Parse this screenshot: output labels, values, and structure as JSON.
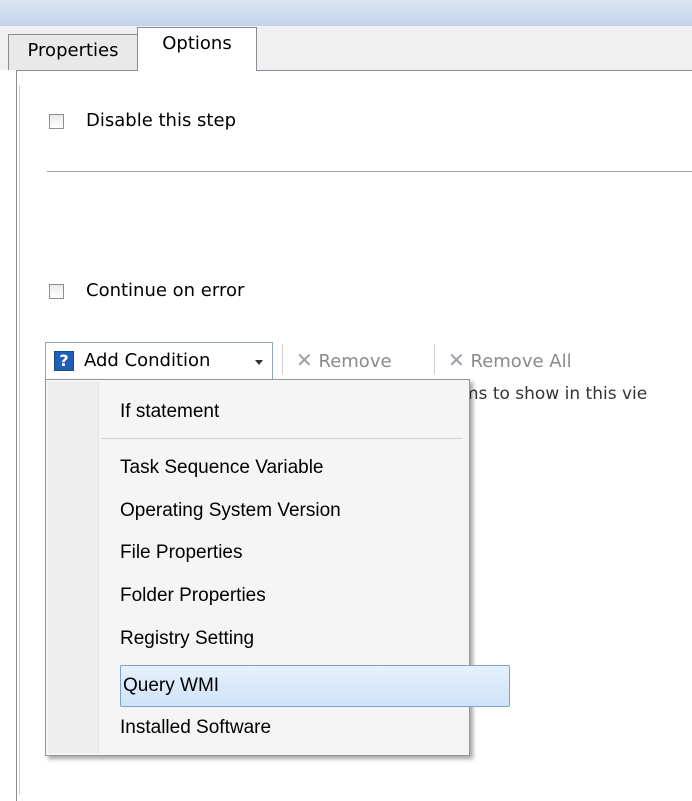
{
  "tabs": [
    {
      "label": "Properties",
      "selected": false
    },
    {
      "label": "Options",
      "selected": true
    }
  ],
  "options": {
    "disable_step_label": "Disable this step",
    "disable_step_checked": false,
    "continue_on_error_label": "Continue on error",
    "continue_on_error_checked": false
  },
  "toolbar": {
    "add_condition_label": "Add Condition",
    "remove_label": "Remove",
    "remove_all_label": "Remove All"
  },
  "list": {
    "empty_text": "ms to show in this vie"
  },
  "menu": {
    "items": [
      {
        "label": "If statement"
      },
      {
        "label": "Task Sequence Variable"
      },
      {
        "label": "Operating System Version"
      },
      {
        "label": "File Properties"
      },
      {
        "label": "Folder Properties"
      },
      {
        "label": "Registry Setting"
      },
      {
        "label": "Query WMI",
        "highlighted": true
      },
      {
        "label": "Installed Software"
      }
    ]
  },
  "colors": {
    "title_bar": "#c8d9ee",
    "menu_highlight": "#cfe3f8",
    "highlight_border": "#7da2ce"
  }
}
